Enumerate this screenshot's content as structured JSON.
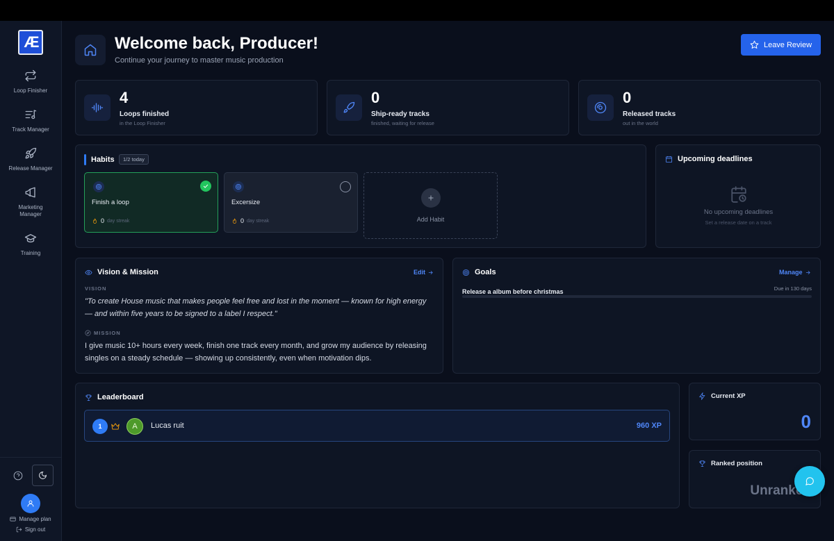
{
  "app": {
    "logo_text": "Æ"
  },
  "sidebar": {
    "items": [
      {
        "label": "Loop Finisher",
        "icon": "repeat-icon"
      },
      {
        "label": "Track Manager",
        "icon": "playlist-icon"
      },
      {
        "label": "Release Manager",
        "icon": "rocket-icon"
      },
      {
        "label": "Marketing Manager",
        "icon": "megaphone-icon"
      },
      {
        "label": "Training",
        "icon": "graduation-cap-icon"
      }
    ],
    "manage_plan": "Manage plan",
    "sign_out": "Sign out"
  },
  "header": {
    "title": "Welcome back, Producer!",
    "subtitle": "Continue your journey to master music production",
    "review_button": "Leave Review"
  },
  "stats": [
    {
      "value": "4",
      "label": "Loops finished",
      "sub": "in the Loop Finisher",
      "icon": "waveform-icon"
    },
    {
      "value": "0",
      "label": "Ship-ready tracks",
      "sub": "finished, waiting for release",
      "icon": "rocket-icon"
    },
    {
      "value": "0",
      "label": "Released tracks",
      "sub": "out in the world",
      "icon": "disc-icon"
    }
  ],
  "habits": {
    "title": "Habits",
    "badge": "1/2 today",
    "items": [
      {
        "name": "Finish a loop",
        "streak": "0",
        "streak_label": "day streak",
        "done": true
      },
      {
        "name": "Excersize",
        "streak": "0",
        "streak_label": "day streak",
        "done": false
      }
    ],
    "add_label": "Add Habit"
  },
  "deadlines": {
    "title": "Upcoming deadlines",
    "empty_title": "No upcoming deadlines",
    "empty_sub": "Set a release date on a track"
  },
  "vision": {
    "title": "Vision & Mission",
    "edit": "Edit",
    "vision_caption": "VISION",
    "vision_text": "\"To create House music that makes people feel free and lost in the moment — known for high energy — and within five years to be signed to a label I respect.\"",
    "mission_caption": "MISSION",
    "mission_text": "I give music 10+ hours every week, finish one track every month, and grow my audience by releasing singles on a steady schedule — showing up consistently, even when motivation dips."
  },
  "goals": {
    "title": "Goals",
    "manage": "Manage",
    "items": [
      {
        "name": "Release a album before christmas",
        "due": "Due in 130 days",
        "progress": 0
      }
    ]
  },
  "leaderboard": {
    "title": "Leaderboard",
    "rows": [
      {
        "rank": "1",
        "avatar_letter": "A",
        "name": "Lucas ruit",
        "xp": "960 XP"
      }
    ]
  },
  "xp": {
    "title": "Current XP",
    "value": "0"
  },
  "ranked": {
    "title": "Ranked position",
    "value": "Unranked"
  },
  "colors": {
    "accent": "#2f7bf5",
    "success": "#22c55e",
    "chat": "#22c3ee"
  }
}
